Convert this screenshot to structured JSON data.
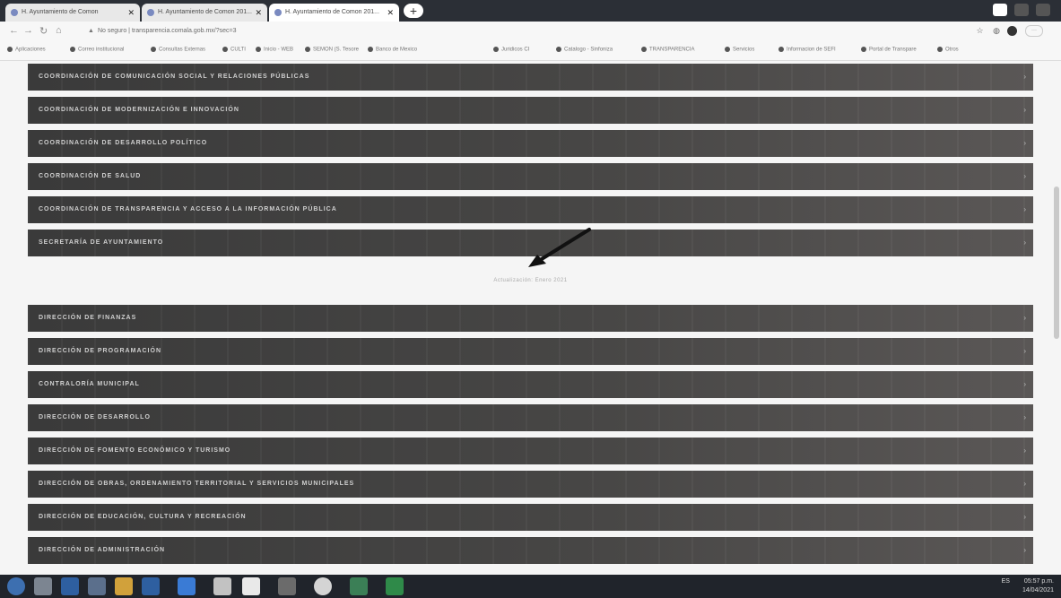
{
  "browser": {
    "tabs": [
      {
        "label": "H. Ayuntamiento de Comon"
      },
      {
        "label": "H. Ayuntamiento de Comon 201..."
      },
      {
        "label": "H. Ayuntamiento de Comon 201..."
      }
    ],
    "new_tab_label": "+",
    "url": "transparencia.comala.gob.mx/?sec=3",
    "lock_label": "No seguro",
    "bookmarks": [
      "Aplicaciones",
      "Correo institucional",
      "Consultas Externas",
      "CULTI",
      "Inicio - WEB",
      "SEMON (S. Tesore",
      "Banco de Mexico",
      "Juridicos CI",
      "Catalogo - Sinfoniza",
      "TRANSPARENCIA",
      "Servicios",
      "Informacion de SEFI",
      "Portal de Transpare",
      "Otros"
    ]
  },
  "sections_top": [
    "COORDINACIÓN DE COMUNICACIÓN SOCIAL Y RELACIONES PÚBLICAS",
    "COORDINACIÓN DE MODERNIZACIÓN E INNOVACIÓN",
    "COORDINACIÓN DE DESARROLLO POLÍTICO",
    "COORDINACIÓN DE SALUD",
    "COORDINACIÓN DE TRANSPARENCIA Y ACCESO A LA INFORMACIÓN PÚBLICA",
    "SECRETARÍA DE AYUNTAMIENTO"
  ],
  "updated_text": "Actualización: Enero 2021",
  "sections_bottom": [
    "DIRECCIÓN DE FINANZAS",
    "DIRECCIÓN DE PROGRAMACIÓN",
    "CONTRALORÍA MUNICIPAL",
    "DIRECCIÓN DE DESARROLLO",
    "DIRECCIÓN DE FOMENTO ECONÓMICO Y TURISMO",
    "DIRECCIÓN DE OBRAS, ORDENAMIENTO TERRITORIAL Y SERVICIOS MUNICIPALES",
    "DIRECCIÓN DE EDUCACIÓN, CULTURA Y RECREACIÓN",
    "DIRECCIÓN DE ADMINISTRACIÓN"
  ],
  "taskbar": {
    "lang": "ES",
    "time": "05:57 p.m.",
    "date": "14/04/2021"
  },
  "colors": {
    "bar_dark": "#3a3a3a",
    "bar_light": "#5a5756",
    "bar_text": "#cfcfcf",
    "page_bg": "#f5f5f5"
  }
}
